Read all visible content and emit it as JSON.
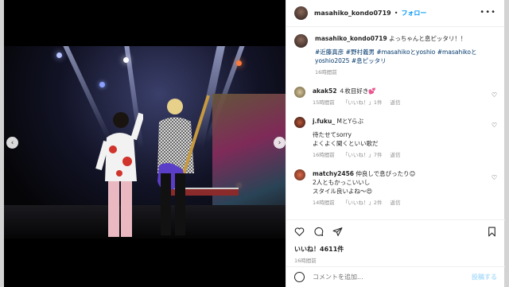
{
  "post": {
    "username": "masahiko_kondo0719",
    "follow_label": "フォロー",
    "more_label": "•••"
  },
  "caption": {
    "username": "masahiko_kondo0719",
    "text": "よっちゃんと息ピッタリ！！",
    "tags": "#近藤真彦 #野村義男 #masahikoとyoshio #masahikoと yoshio2025 #息ピッタリ",
    "time": "16時間前"
  },
  "comments": [
    {
      "user": "akak52",
      "text": "４枚目好き💕",
      "time": "15時間前",
      "likes": "「いいね！」1件",
      "reply": "返信"
    },
    {
      "user": "j.fuku_",
      "text": "MとYらぶ",
      "line2": "待たせてsorry",
      "line3": "よくよく聞くといい歌だ",
      "time": "16時間前",
      "likes": "「いいね！」7件",
      "reply": "返信"
    },
    {
      "user": "matchy2456",
      "text": "仲良しで息ぴったり😊",
      "line2": "2人ともかっこいいし",
      "line3": "スタイル良いよね～😍",
      "time": "14時間前",
      "likes": "「いいね！」2件",
      "reply": "返信"
    }
  ],
  "actions": {
    "likes_text": "いいね！4611件",
    "time": "16時間前"
  },
  "compose": {
    "placeholder": "コメントを追加...",
    "post_label": "投稿する"
  },
  "icons": {
    "heart": "heart-icon",
    "comment": "comment-icon",
    "share": "share-icon",
    "bookmark": "bookmark-icon",
    "emoji": "emoji-icon"
  }
}
